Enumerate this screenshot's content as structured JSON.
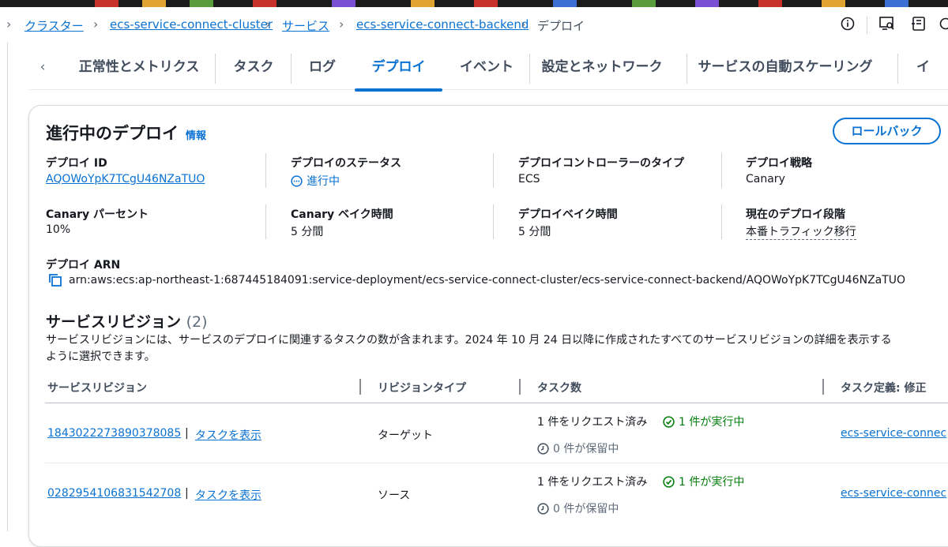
{
  "breadcrumb": {
    "items": [
      {
        "label": "クラスター"
      },
      {
        "label": "ecs-service-connect-cluster"
      },
      {
        "label": "サービス"
      },
      {
        "label": "ecs-service-connect-backend"
      },
      {
        "label": "デプロイ"
      }
    ]
  },
  "tabs": [
    {
      "label": "正常性とメトリクス"
    },
    {
      "label": "タスク"
    },
    {
      "label": "ログ"
    },
    {
      "label": "デプロイ",
      "active": true
    },
    {
      "label": "イベント"
    },
    {
      "label": "設定とネットワーク"
    },
    {
      "label": "サービスの自動スケーリング"
    },
    {
      "label": "イ"
    }
  ],
  "deployment": {
    "title": "進行中のデプロイ",
    "info_link": "情報",
    "rollback_button": "ロールバック",
    "fields": [
      {
        "label": "デプロイ ID",
        "value": "AQOWoYpK7TCgU46NZaTUO"
      },
      {
        "label": "デプロイのステータス",
        "value": "進行中"
      },
      {
        "label": "デプロイコントローラーのタイプ",
        "value": "ECS"
      },
      {
        "label": "デプロイ戦略",
        "value": "Canary"
      },
      {
        "label": "Canary パーセント",
        "value": "10%"
      },
      {
        "label": "Canary ベイク時間",
        "value": "5 分間"
      },
      {
        "label": "デプロイベイク時間",
        "value": "5 分間"
      },
      {
        "label": "現在のデプロイ段階",
        "value": "本番トラフィック移行"
      }
    ],
    "arn_label": "デプロイ ARN",
    "arn_value": "arn:aws:ecs:ap-northeast-1:687445184091:service-deployment/ecs-service-connect-cluster/ecs-service-connect-backend/AQOWoYpK7TCgU46NZaTUO"
  },
  "revisions": {
    "title": "サービスリビジョン",
    "count": "(2)",
    "description_line1": "サービスリビジョンには、サービスのデプロイに関連するタスクの数が含まれます。2024 年 10 月 24 日以降に作成されたすべてのサービスリビジョンの詳細を表示する",
    "description_line2": "ように選択できます。",
    "columns": [
      "サービスリビジョン",
      "リビジョンタイプ",
      "タスク数",
      "タスク定義: 修正"
    ],
    "separator": "|",
    "rows": [
      {
        "revision": "1843022273890378085",
        "view_tasks": "タスクを表示",
        "type": "ターゲット",
        "requested": "1 件をリクエスト済み",
        "running": "1 件が実行中",
        "pending": "0 件が保留中",
        "task_def": "ecs-service-connec"
      },
      {
        "revision": "0282954106831542708",
        "view_tasks": "タスクを表示",
        "type": "ソース",
        "requested": "1 件をリクエスト済み",
        "running": "1 件が実行中",
        "pending": "0 件が保留中",
        "task_def": "ecs-service-connec"
      }
    ]
  },
  "colors": {
    "link": "#0972d3",
    "success": "#037f0c",
    "text": "#16191f",
    "muted": "#5f6b7a"
  }
}
